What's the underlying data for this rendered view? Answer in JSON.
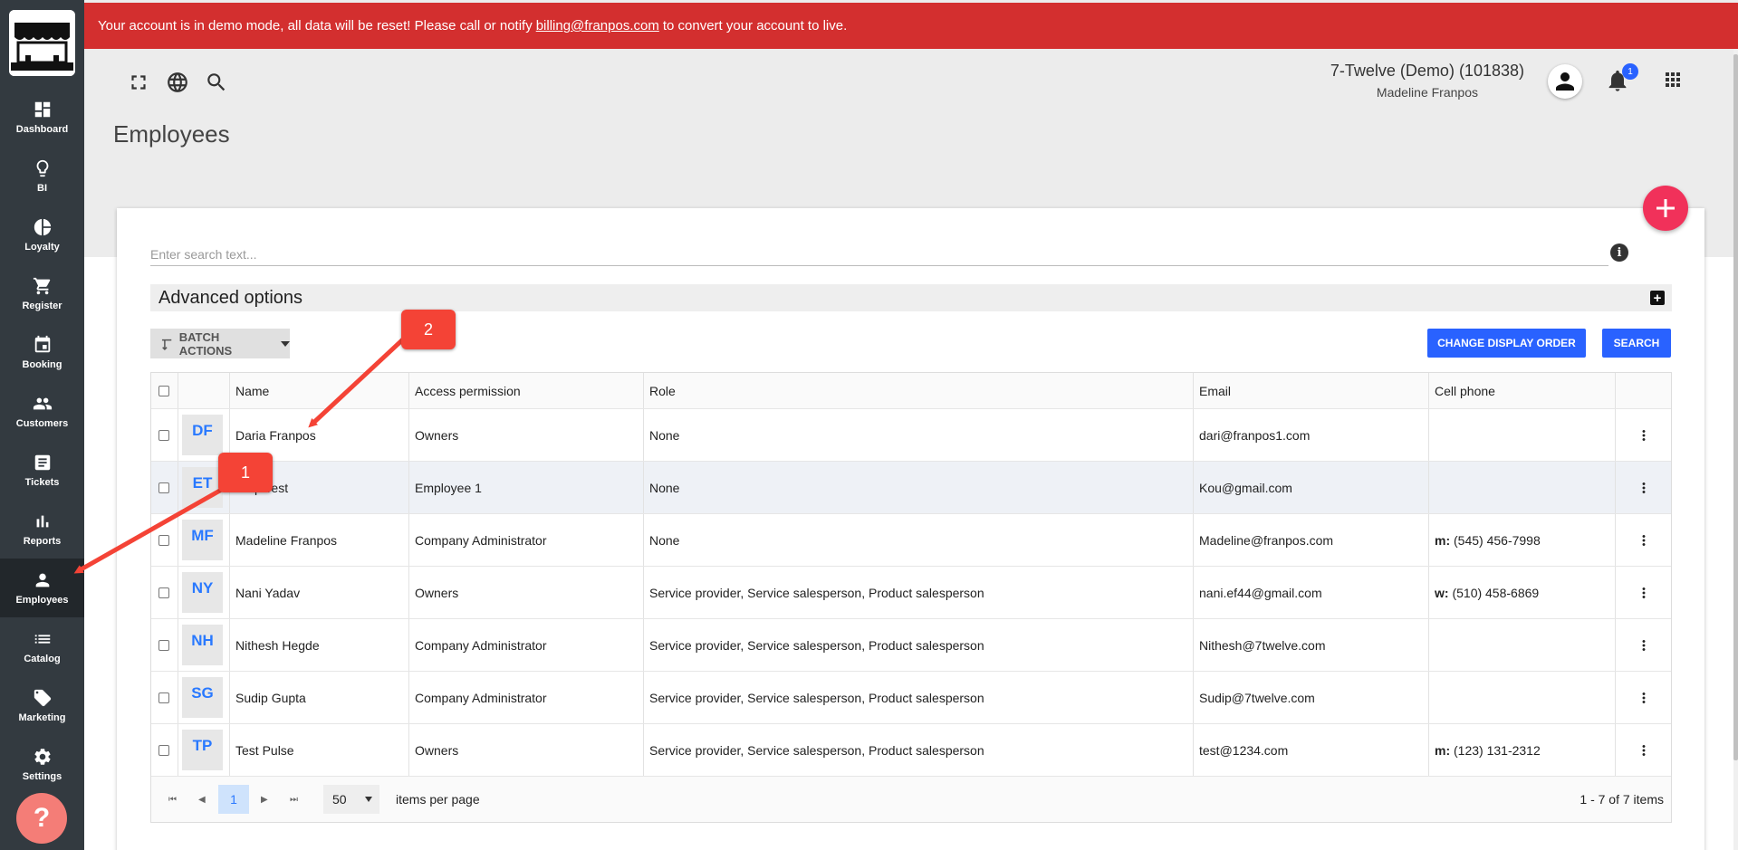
{
  "banner": {
    "prefix": "Your account is in demo mode, all data will be reset! Please call or notify",
    "email": "billing@franpos.com",
    "suffix": "to convert your account to live."
  },
  "sidebar": {
    "items": [
      {
        "label": "Dashboard",
        "icon": "dashboard-icon"
      },
      {
        "label": "BI",
        "icon": "lightbulb-icon"
      },
      {
        "label": "Loyalty",
        "icon": "pie-chart-icon"
      },
      {
        "label": "Register",
        "icon": "cart-icon"
      },
      {
        "label": "Booking",
        "icon": "calendar-icon"
      },
      {
        "label": "Customers",
        "icon": "people-icon"
      },
      {
        "label": "Tickets",
        "icon": "ticket-icon"
      },
      {
        "label": "Reports",
        "icon": "bar-chart-icon"
      },
      {
        "label": "Employees",
        "icon": "person-icon"
      },
      {
        "label": "Catalog",
        "icon": "list-icon"
      },
      {
        "label": "Marketing",
        "icon": "tag-icon"
      },
      {
        "label": "Settings",
        "icon": "gear-icon"
      }
    ],
    "active": "Employees",
    "help_label": "?"
  },
  "header": {
    "company": "7-Twelve (Demo) (101838)",
    "user": "Madeline Franpos",
    "notification_count": "1"
  },
  "page": {
    "title": "Employees",
    "search_placeholder": "Enter search text...",
    "advanced_options": "Advanced options",
    "advanced_toggle": "+",
    "batch_actions": "BATCH ACTIONS",
    "change_display_order": "CHANGE DISPLAY ORDER",
    "search": "SEARCH"
  },
  "table": {
    "columns": [
      "Name",
      "Access permission",
      "Role",
      "Email",
      "Cell phone"
    ],
    "rows": [
      {
        "initials": "DF",
        "name": "Daria Franpos",
        "access": "Owners",
        "role": "None",
        "email": "dari@franpos1.com",
        "phone_type": "",
        "phone": ""
      },
      {
        "initials": "ET",
        "name": "Emp Test",
        "access": "Employee 1",
        "role": "None",
        "email": "Kou@gmail.com",
        "phone_type": "",
        "phone": ""
      },
      {
        "initials": "MF",
        "name": "Madeline Franpos",
        "access": "Company Administrator",
        "role": "None",
        "email": "Madeline@franpos.com",
        "phone_type": "m:",
        "phone": "(545) 456-7998"
      },
      {
        "initials": "NY",
        "name": "Nani Yadav",
        "access": "Owners",
        "role": "Service provider, Service salesperson, Product salesperson",
        "email": "nani.ef44@gmail.com",
        "phone_type": "w:",
        "phone": "(510) 458-6869"
      },
      {
        "initials": "NH",
        "name": "Nithesh Hegde",
        "access": "Company Administrator",
        "role": "Service provider, Service salesperson, Product salesperson",
        "email": "Nithesh@7twelve.com",
        "phone_type": "",
        "phone": ""
      },
      {
        "initials": "SG",
        "name": "Sudip Gupta",
        "access": "Company Administrator",
        "role": "Service provider, Service salesperson, Product salesperson",
        "email": "Sudip@7twelve.com",
        "phone_type": "",
        "phone": ""
      },
      {
        "initials": "TP",
        "name": "Test Pulse",
        "access": "Owners",
        "role": "Service provider, Service salesperson, Product salesperson",
        "email": "test@1234.com",
        "phone_type": "m:",
        "phone": "(123) 131-2312"
      }
    ]
  },
  "pagination": {
    "current_page": "1",
    "per_page": "50",
    "per_page_label": "items per page",
    "summary": "1 - 7 of 7 items"
  },
  "annotations": [
    {
      "label": "1"
    },
    {
      "label": "2"
    }
  ],
  "colors": {
    "banner": "#d32f2f",
    "sidebar": "#333a40",
    "accent": "#2962ff",
    "fab": "#f1315a",
    "annotation": "#f44336"
  }
}
